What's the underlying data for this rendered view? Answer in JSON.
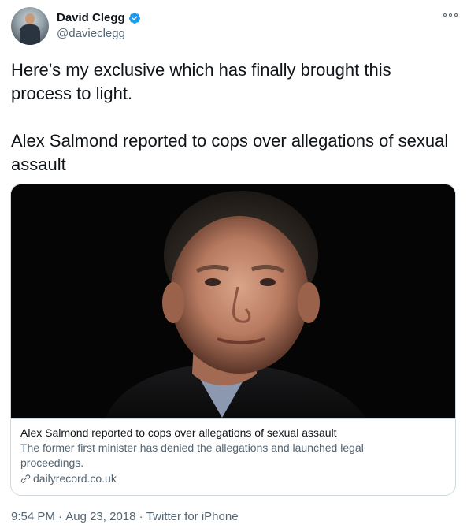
{
  "author": {
    "display_name": "David Clegg",
    "handle": "@davieclegg",
    "verified": true,
    "verified_color": "#1d9bf0"
  },
  "tweet": {
    "paragraphs": [
      "Here’s my exclusive which has finally brought this process to light.",
      "Alex Salmond reported to cops over allegations of sexual assault"
    ]
  },
  "card": {
    "title": "Alex Salmond reported to cops over allegations of sexual assault",
    "description": "The former first minister has denied the allegations and launched legal proceedings.",
    "domain": "dailyrecord.co.uk"
  },
  "meta": {
    "time": "9:54 PM",
    "separator": " · ",
    "date": "Aug 23, 2018",
    "source": "Twitter for iPhone"
  },
  "icons": {
    "more": "more-options-icon",
    "verified": "verified-badge-icon",
    "link": "link-icon"
  }
}
